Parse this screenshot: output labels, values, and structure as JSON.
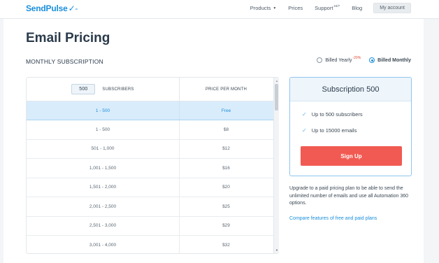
{
  "brand": {
    "logo_text": "SendPulse",
    "logo_mark": "✓-"
  },
  "nav": {
    "products": "Products",
    "prices": "Prices",
    "support": "Support",
    "support_sup": "24/7",
    "blog": "Blog",
    "account": "My account"
  },
  "page": {
    "title": "Email Pricing",
    "section": "MONTHLY SUBSCRIPTION"
  },
  "billing": {
    "yearly_label": "Billed Yearly",
    "yearly_discount": "-20%",
    "monthly_label": "Billed Monthly",
    "selected": "monthly"
  },
  "table": {
    "subscriber_value": "500",
    "subscribers_header": "SUBSCRIBERS",
    "price_header": "PRICE PER MONTH",
    "active_row": {
      "range": "1 - 500",
      "price": "Free"
    },
    "rows": [
      {
        "range": "1 - 500",
        "price": "$8"
      },
      {
        "range": "501 - 1,000",
        "price": "$12"
      },
      {
        "range": "1,001 - 1,500",
        "price": "$16"
      },
      {
        "range": "1,501 - 2,000",
        "price": "$20"
      },
      {
        "range": "2,001 - 2,500",
        "price": "$25"
      },
      {
        "range": "2,501 - 3,000",
        "price": "$29"
      },
      {
        "range": "3,001 - 4,000",
        "price": "$32"
      }
    ]
  },
  "card": {
    "title": "Subscription 500",
    "features": [
      "Up to 500 subscribers",
      "Up to 15000 emails"
    ],
    "button": "Sign Up"
  },
  "upgrade_text": "Upgrade to a paid pricing plan to be able to send the unlimited number of emails and use all Automation 360 options.",
  "compare_link": "Compare features of free and paid plans",
  "colors": {
    "accent": "#1a8fdc",
    "cta": "#f15a52",
    "active_row": "#d9ecfb"
  }
}
